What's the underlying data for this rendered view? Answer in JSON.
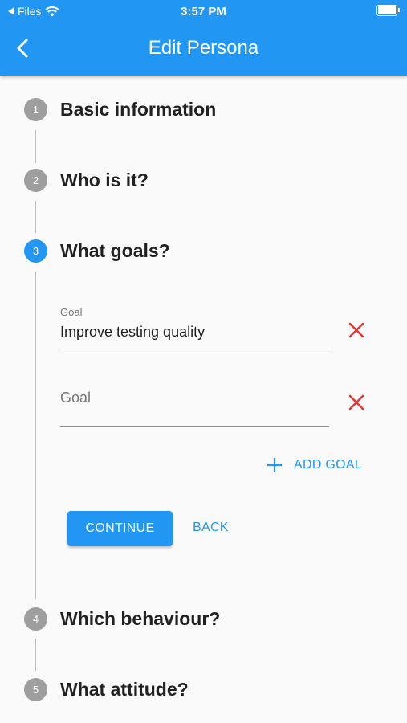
{
  "status_bar": {
    "back_app": "Files",
    "time": "3:57 PM"
  },
  "header": {
    "title": "Edit Persona"
  },
  "steps": [
    {
      "number": "1",
      "title": "Basic information"
    },
    {
      "number": "2",
      "title": "Who is it?"
    },
    {
      "number": "3",
      "title": "What goals?"
    },
    {
      "number": "4",
      "title": "Which behaviour?"
    },
    {
      "number": "5",
      "title": "What attitude?"
    }
  ],
  "active_step": 3,
  "goals": {
    "field1": {
      "label": "Goal",
      "value": "Improve testing quality"
    },
    "field2": {
      "placeholder": "Goal"
    },
    "add_label": "ADD GOAL"
  },
  "actions": {
    "continue_label": "CONTINUE",
    "back_label": "BACK"
  },
  "colors": {
    "primary": "#2196f3",
    "remove": "#e53935",
    "inactive_step": "#9e9e9e"
  }
}
